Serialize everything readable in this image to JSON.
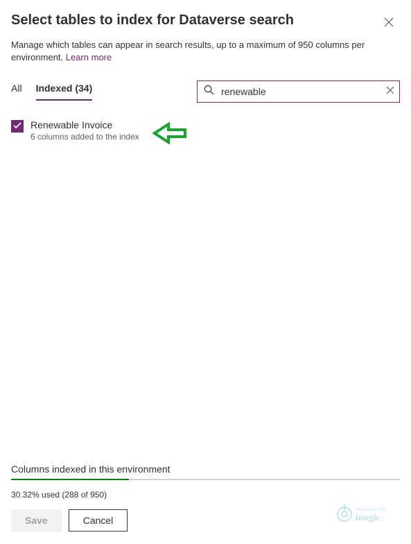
{
  "header": {
    "title": "Select tables to index for Dataverse search",
    "subtitle_prefix": "Manage which tables can appear in search results, up to a maximum of 950 columns per environment. ",
    "learn_more": "Learn more"
  },
  "tabs": {
    "all": "All",
    "indexed": "Indexed (34)"
  },
  "search": {
    "value": "renewable"
  },
  "results": [
    {
      "title": "Renewable Invoice",
      "sub": "6 columns added to the index",
      "checked": true
    }
  ],
  "footer": {
    "label": "Columns indexed in this environment",
    "usage_text": "30.32% used (288 of 950)",
    "progress_percent": 30.32,
    "save": "Save",
    "cancel": "Cancel"
  },
  "watermark": {
    "brand": "inogic",
    "tagline": "innovative logic"
  }
}
